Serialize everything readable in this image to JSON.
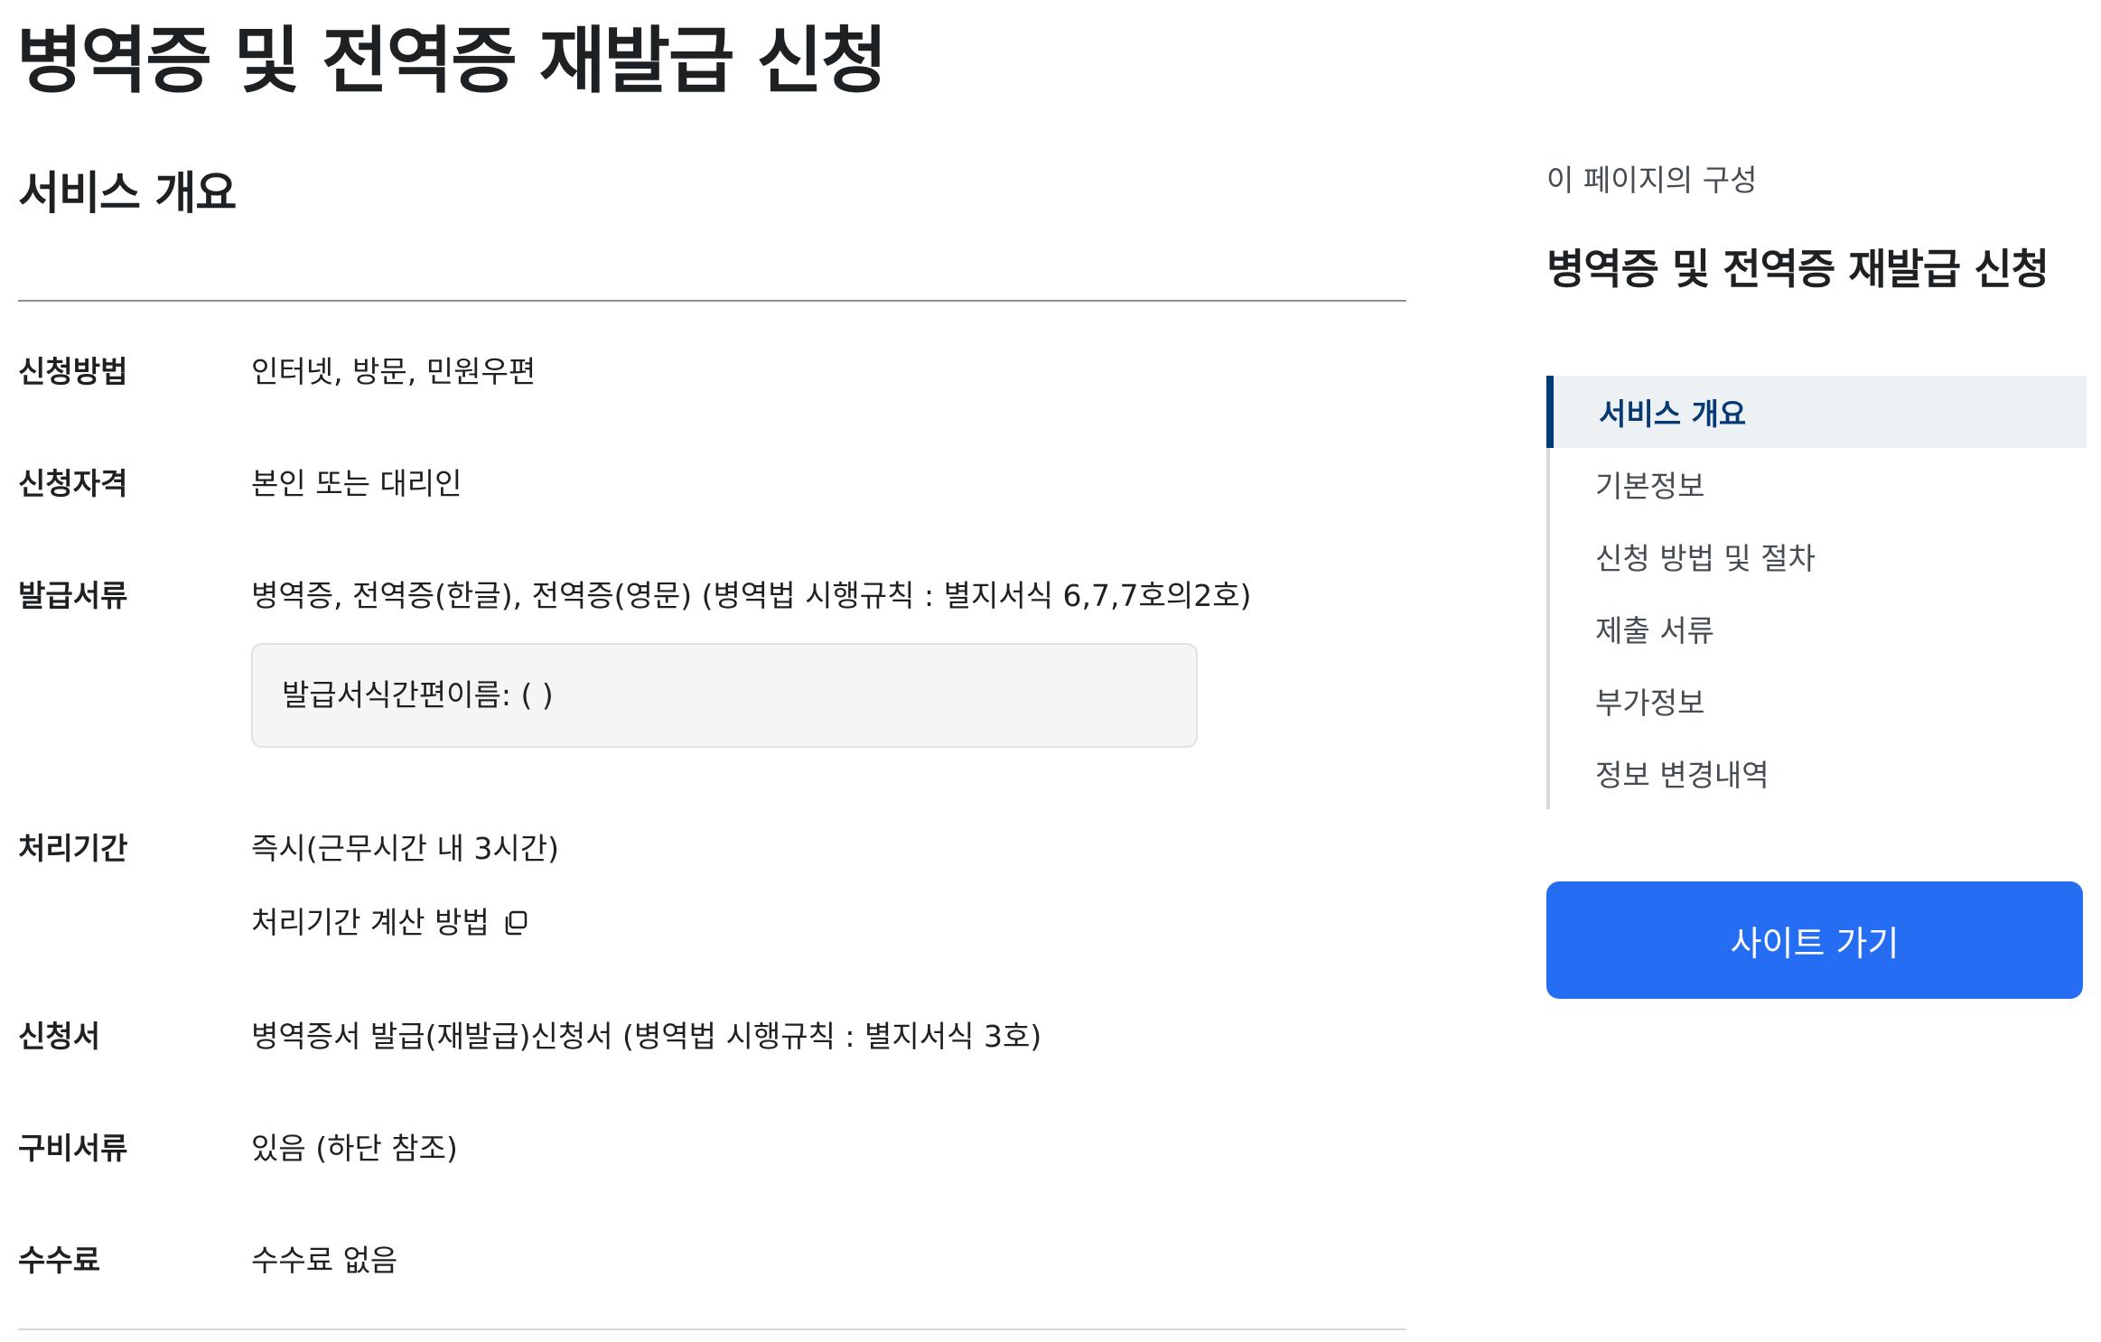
{
  "page": {
    "title": "병역증 및 전역증 재발급 신청"
  },
  "main": {
    "section_title": "서비스 개요",
    "rows": [
      {
        "label": "신청방법",
        "value": "인터넷, 방문, 민원우편"
      },
      {
        "label": "신청자격",
        "value": "본인 또는 대리인"
      },
      {
        "label": "발급서류",
        "value": "병역증, 전역증(한글), 전역증(영문) (병역법 시행규칙 : 별지서식 6,7,7호의2호)",
        "note": "발급서식간편이름: ( )"
      },
      {
        "label": "처리기간",
        "value": "즉시(근무시간 내 3시간)",
        "sub_link": "처리기간 계산 방법",
        "sub_icon": "copy-icon"
      },
      {
        "label": "신청서",
        "value": "병역증서 발급(재발급)신청서 (병역법 시행규칙 : 별지서식 3호)"
      },
      {
        "label": "구비서류",
        "value": "있음 (하단 참조)"
      },
      {
        "label": "수수료",
        "value": "수수료 없음"
      }
    ]
  },
  "sidebar": {
    "caption": "이 페이지의 구성",
    "title": "병역증 및 전역증 재발급 신청",
    "items": [
      {
        "label": "서비스 개요",
        "active": true
      },
      {
        "label": "기본정보",
        "active": false
      },
      {
        "label": "신청 방법 및 절차",
        "active": false
      },
      {
        "label": "제출 서류",
        "active": false
      },
      {
        "label": "부가정보",
        "active": false
      },
      {
        "label": "정보 변경내역",
        "active": false
      }
    ],
    "button_label": "사이트 가기"
  },
  "colors": {
    "text": "#1e2124",
    "active_nav": "#063a74",
    "active_nav_bg": "#eef1f4",
    "primary_button": "#256ef4",
    "note_bg": "#f4f5f6"
  }
}
